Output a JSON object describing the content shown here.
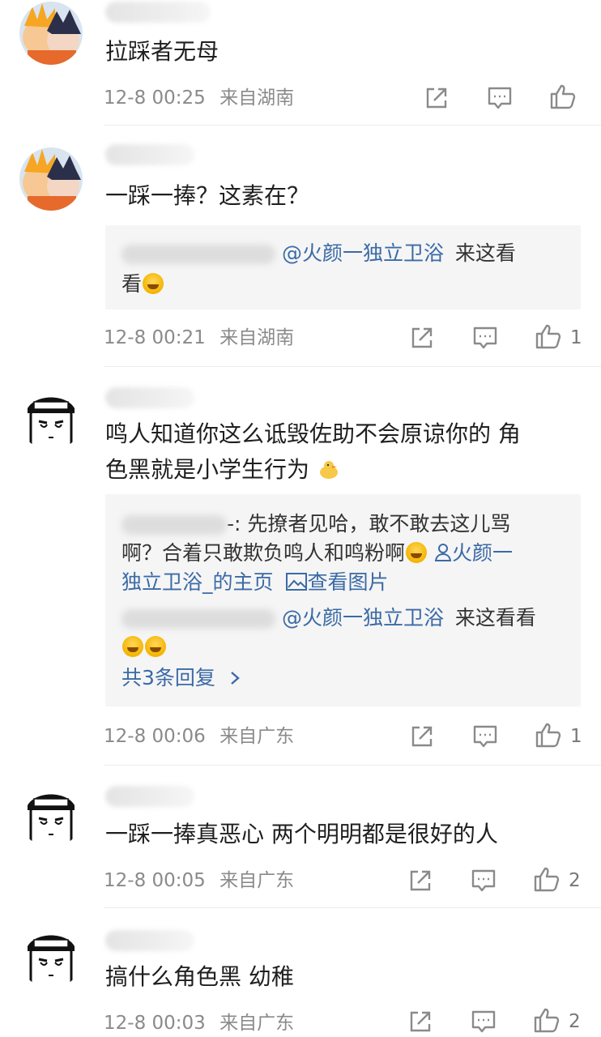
{
  "comments": [
    {
      "text": "拉踩者无母",
      "time": "12-8 00:25",
      "location": "来自湖南",
      "likes": ""
    },
    {
      "text": "一踩一捧？这素在？",
      "reply_preview": {
        "line1_mention": "@火颜一独立卫浴",
        "line1_suffix": "来这看",
        "line2": "看"
      },
      "time": "12-8 00:21",
      "location": "来自湖南",
      "likes": "1"
    },
    {
      "text_line1": "鸣人知道你这么诋毁佐助不会原谅你的 角",
      "text_line2": "色黑就是小学生行为",
      "reply_preview": {
        "r1_line1": "-: 先撩者见哈，敢不敢去这儿骂",
        "r1_line2": "啊？合着只敢欺负鸣人和鸣粉啊",
        "r1_link1": "火颜一",
        "r1_link2": "独立卫浴_的主页",
        "r1_link3": "查看图片",
        "r2_mention": "@火颜一独立卫浴",
        "r2_suffix": "来这看看",
        "more": "共3条回复"
      },
      "time": "12-8 00:06",
      "location": "来自广东",
      "likes": "1"
    },
    {
      "text": "一踩一捧真恶心 两个明明都是很好的人",
      "time": "12-8 00:05",
      "location": "来自广东",
      "likes": "2"
    },
    {
      "text": "搞什么角色黑 幼稚",
      "time": "12-8 00:03",
      "location": "来自广东",
      "likes": "2"
    }
  ],
  "colors": {
    "link": "#3b6aa6",
    "meta": "#8a8a8a",
    "quote_bg": "#f5f5f5"
  },
  "icons": [
    "share-icon",
    "comment-icon",
    "like-icon",
    "user-icon",
    "image-icon",
    "chevron-right-icon"
  ]
}
